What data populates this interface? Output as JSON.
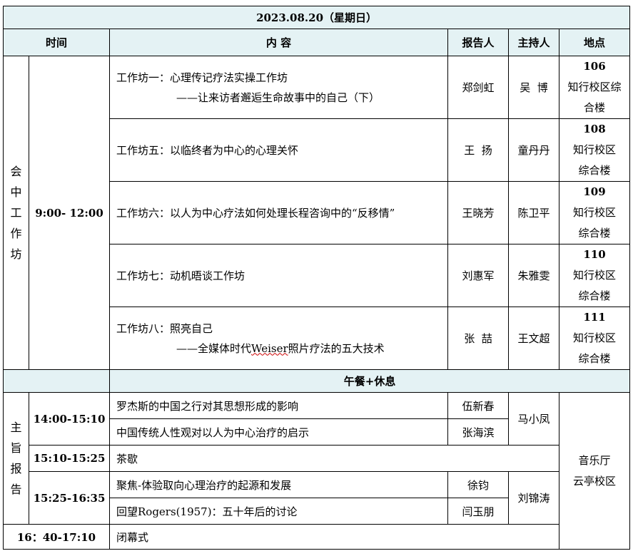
{
  "date_header": "2023.08.20（星期日）",
  "columns": {
    "time": "时间",
    "content": "内 容",
    "reporter": "报告人",
    "host": "主持人",
    "location": "地点"
  },
  "workshop": {
    "session_label": [
      "会",
      "中",
      "工",
      "作",
      "坊"
    ],
    "time": "9:00- 12:00",
    "rows": [
      {
        "title": "工作坊一：心理传记疗法实操工作坊",
        "subtitle": "——让来访者邂逅生命故事中的自己（下）",
        "reporter": "郑剑虹",
        "host": "吴  博",
        "room": "106",
        "loc1": "知行校区综",
        "loc2": "合楼"
      },
      {
        "title": "工作坊五：以临终者为中心的心理关怀",
        "subtitle": "",
        "reporter": "王  扬",
        "host": "童丹丹",
        "room": "108",
        "loc1": "知行校区",
        "loc2": "综合楼"
      },
      {
        "title": "工作坊六：以人为中心疗法如何处理长程咨询中的“反移情”",
        "subtitle": "",
        "reporter": "王晓芳",
        "host": "陈卫平",
        "room": "109",
        "loc1": "知行校区",
        "loc2": "综合楼"
      },
      {
        "title": "工作坊七：动机晤谈工作坊",
        "subtitle": "",
        "reporter": "刘惠军",
        "host": "朱雅雯",
        "room": "110",
        "loc1": "知行校区",
        "loc2": "综合楼"
      },
      {
        "title": "工作坊八：照亮自己",
        "subtitle_pre": "——全媒体时代",
        "subtitle_word": "Weiser",
        "subtitle_post": "照片疗法的五大技术",
        "reporter": "张  喆",
        "host": "王文超",
        "room": "111",
        "loc1": "知行校区",
        "loc2": "综合楼"
      }
    ]
  },
  "lunch": "午餐+休息",
  "keynote": {
    "session_label": [
      "主",
      "旨",
      "报",
      "告"
    ],
    "time1": "14:00-15:10",
    "talk1": "罗杰斯的中国之行对其思想形成的影响",
    "talk1_reporter": "伍新春",
    "talk2": "中国传统人性观对以人为中心治疗的启示",
    "talk2_reporter": "张海滨",
    "host1": "马小凤",
    "time2": "15:10-15:25",
    "tea": "茶歇",
    "time3": "15:25-16:35",
    "talk3": "聚焦-体验取向心理治疗的起源和发展",
    "talk3_reporter": "徐钧",
    "talk4": "回望Rogers(1957)：五十年后的讨论",
    "talk4_reporter": "闫玉朋",
    "host2": "刘锦涛",
    "location1": "音乐厅",
    "location2": "云亭校区"
  },
  "closing": {
    "time": "16：40-17:10",
    "label": "闭幕式"
  }
}
